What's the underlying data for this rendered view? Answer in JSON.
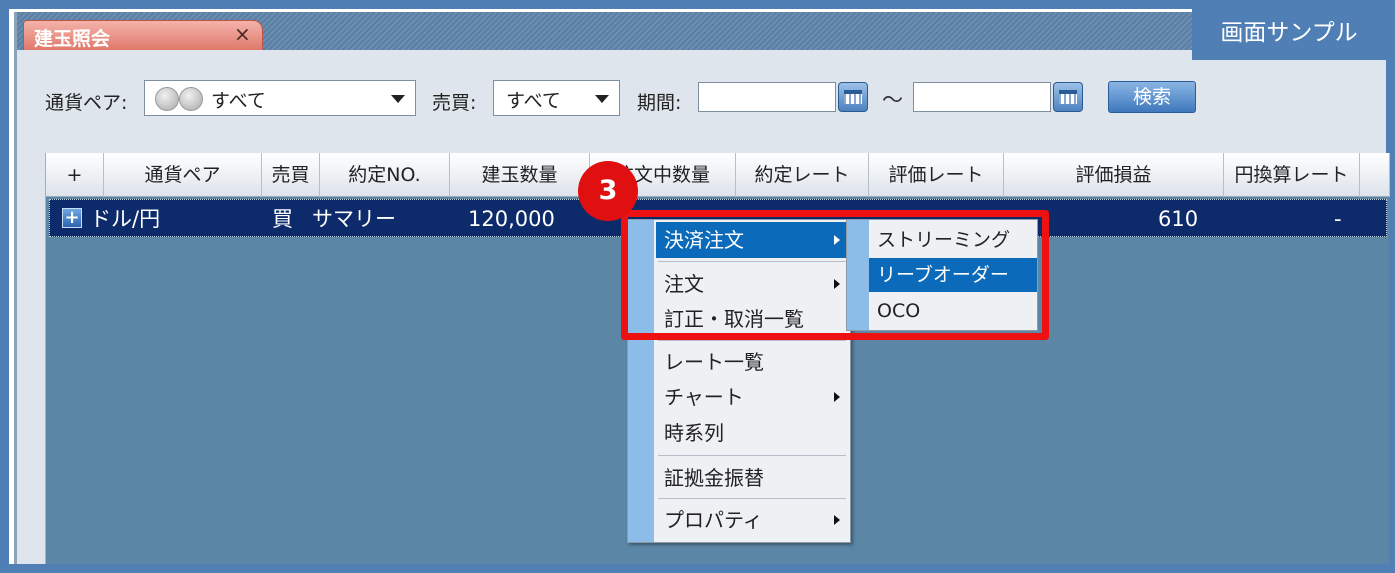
{
  "tab": {
    "title": "建玉照会",
    "close": "×"
  },
  "badge": "画面サンプル",
  "filters": {
    "pair_label": "通貨ペア:",
    "pair_value": "すべて",
    "side_label": "売買:",
    "side_value": "すべて",
    "period_label": "期間:",
    "period_from": "",
    "period_to": "",
    "tilde": "～",
    "search_label": "検索"
  },
  "table": {
    "headers": [
      "+",
      "通貨ペア",
      "売買",
      "約定NO.",
      "建玉数量",
      "注文中数量",
      "約定レート",
      "評価レート",
      "評価損益",
      "円換算レート"
    ],
    "row": {
      "pair": "ドル/円",
      "side": "買",
      "contract": "サマリー",
      "qty": "120,000",
      "pnl": "610",
      "yen_rate": "-"
    }
  },
  "context_menu": {
    "items": [
      {
        "label": "決済注文",
        "has_sub": true,
        "selected": true
      },
      {
        "label": "注文",
        "has_sub": true
      },
      {
        "label": "訂正・取消一覧",
        "has_sub": false
      },
      {
        "label": "レート一覧",
        "has_sub": false
      },
      {
        "label": "チャート",
        "has_sub": true
      },
      {
        "label": "時系列",
        "has_sub": false
      },
      {
        "label": "証拠金振替",
        "has_sub": false
      },
      {
        "label": "プロパティ",
        "has_sub": true
      }
    ]
  },
  "submenu": {
    "items": [
      {
        "label": "ストリーミング"
      },
      {
        "label": "リーブオーダー",
        "selected": true
      },
      {
        "label": "OCO"
      }
    ]
  },
  "step_number": "3",
  "colors": {
    "frame": "#4f7fb5",
    "highlight": "#ee1111",
    "selection": "#0b6bba",
    "grid_bg": "#5b86a6"
  }
}
